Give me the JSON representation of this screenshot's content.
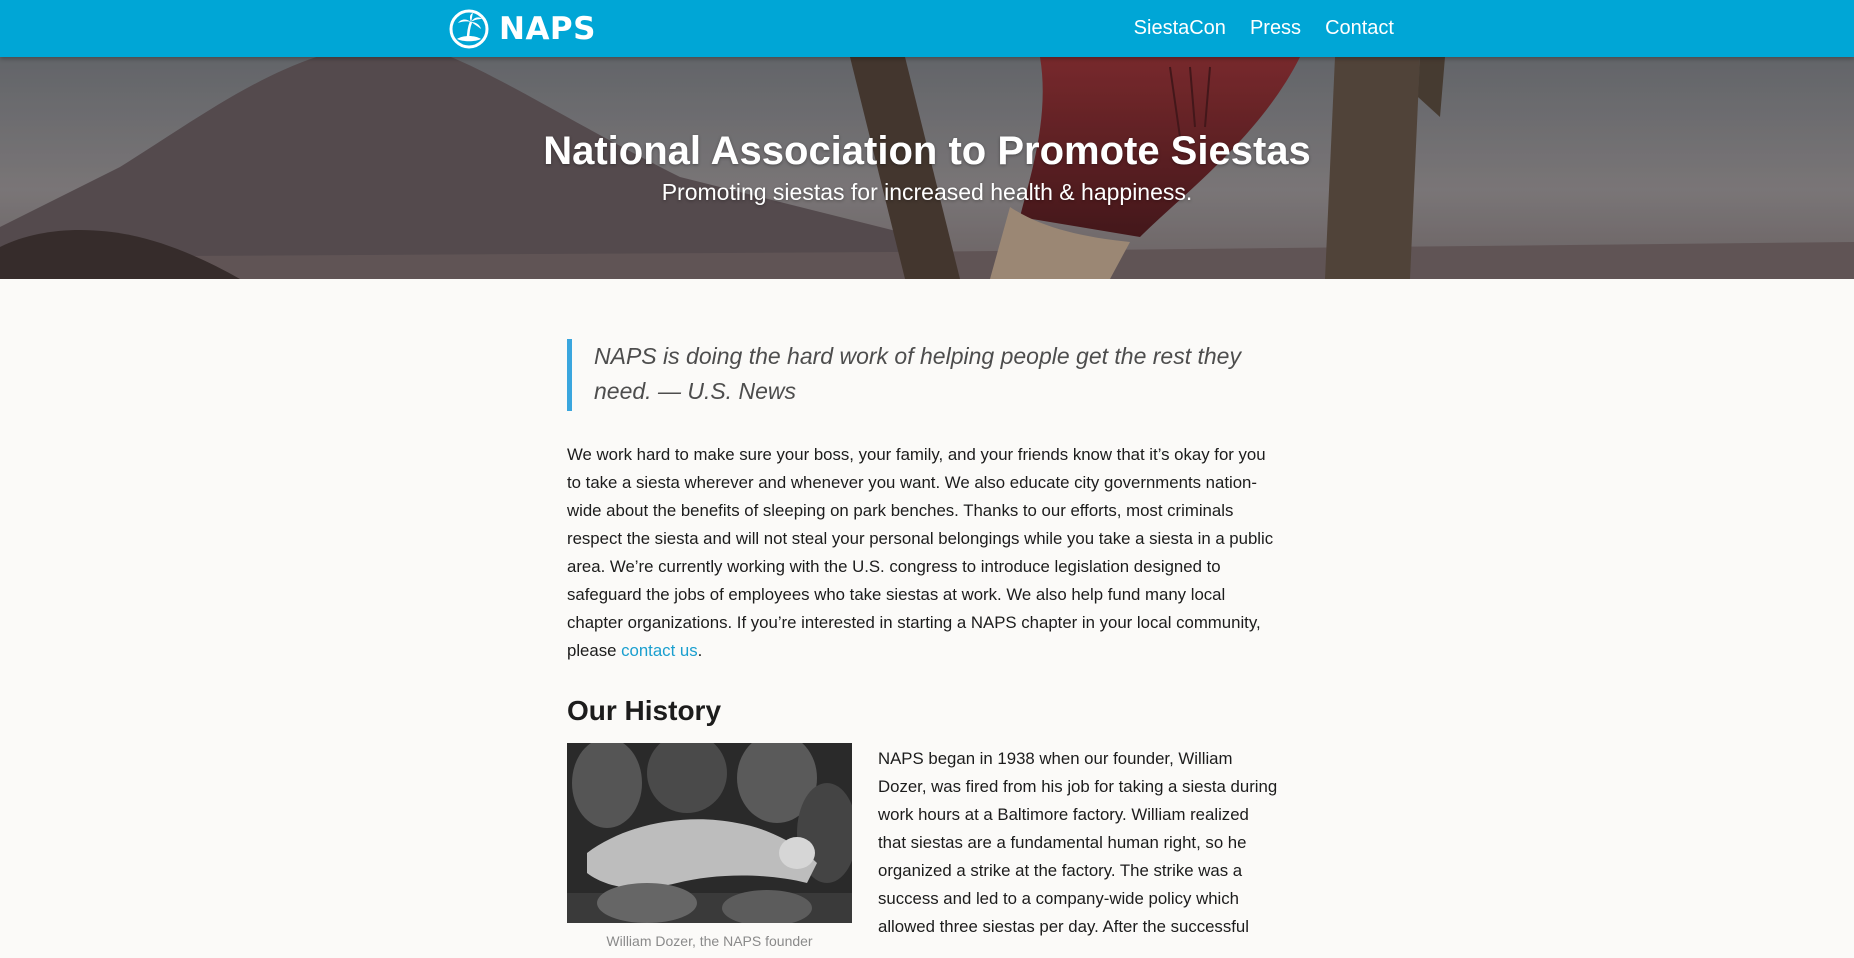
{
  "navbar": {
    "brand": "NAPS",
    "logo_icon": "palm-island-logo-icon",
    "links": [
      "SiestaCon",
      "Press",
      "Contact"
    ]
  },
  "hero": {
    "title": "National Association to Promote Siestas",
    "subtitle": "Promoting siestas for increased health & happiness."
  },
  "quote": {
    "text": "NAPS is doing the hard work of helping people get the rest they need. — U.S. News"
  },
  "intro": {
    "text": "We work hard to make sure your boss, your family, and your friends know that it’s okay for you to take a siesta wherever and whenever you want. We also educate city governments nation-wide about the benefits of sleeping on park benches. Thanks to our efforts, most criminals respect the siesta and will not steal your personal belongings while you take a siesta in a public area. We’re currently working with the U.S. congress to introduce legislation designed to safeguard the jobs of employees who take siestas at work. We also help fund many local chapter organizations. If you’re interested in starting a NAPS chapter in your local community, please ",
    "link": "contact us",
    "end": "."
  },
  "history": {
    "heading": "Our History",
    "caption": "William Dozer, the NAPS founder",
    "text": "NAPS began in 1938 when our founder, William Dozer, was fired from his job for taking a siesta during work hours at a Baltimore factory. William realized that siestas are a fundamental human right, so he organized a strike at the factory. The strike was a success and led to a company-wide policy which allowed three siestas per day. After the successful"
  },
  "colors": {
    "navbar": "#00a6d6",
    "link": "#1a9fcf",
    "quote_border": "#3aa6de",
    "background": "#fbfaf8"
  }
}
